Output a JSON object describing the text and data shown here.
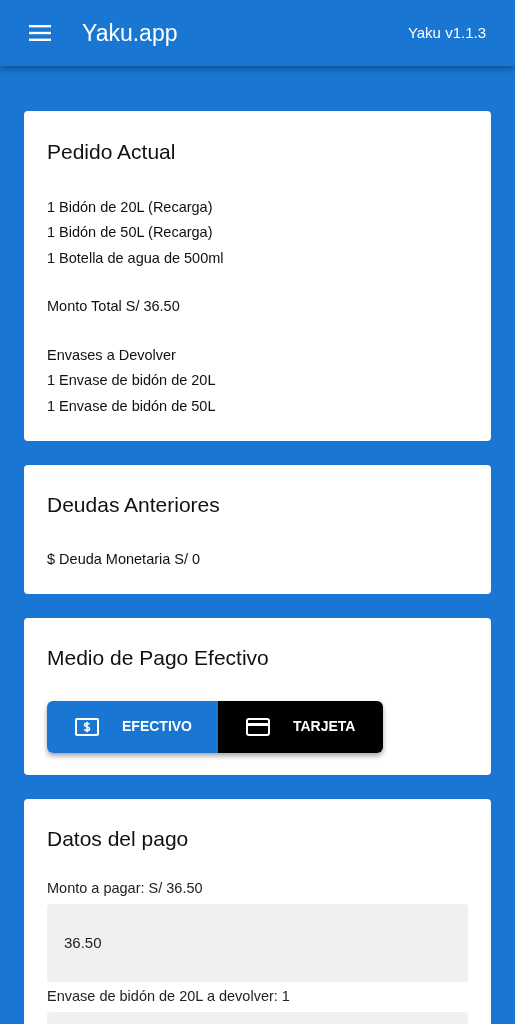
{
  "app_bar": {
    "title": "Yaku.app",
    "version": "Yaku v1.1.3"
  },
  "current_order": {
    "title": "Pedido Actual",
    "items": [
      "1 Bidón de 20L (Recarga)",
      "1 Bidón de 50L (Recarga)",
      "1 Botella de agua de 500ml"
    ],
    "total": "Monto Total S/ 36.50",
    "returns_title": "Envases a Devolver",
    "returns": [
      "1 Envase de bidón de 20L",
      "1 Envase de bidón de 50L"
    ]
  },
  "previous_debts": {
    "title": "Deudas Anteriores",
    "lines": [
      "$ Deuda Monetaria S/ 0"
    ]
  },
  "payment_method": {
    "title": "Medio de Pago Efectivo",
    "options": [
      {
        "kind": "cash",
        "label": "EFECTIVO",
        "selected": true
      },
      {
        "kind": "card",
        "label": "TARJETA",
        "selected": false
      }
    ]
  },
  "payment_data": {
    "title": "Datos del pago",
    "fields": [
      {
        "label": "Monto a pagar: S/ 36.50",
        "value": "36.50"
      },
      {
        "label": "Envase de bidón de 20L a devolver: 1"
      }
    ]
  }
}
